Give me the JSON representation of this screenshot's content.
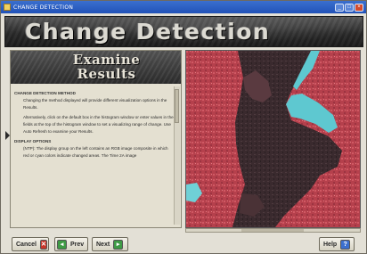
{
  "window": {
    "title": "CHANGE DETECTION",
    "controls": [
      "_",
      "□",
      "×"
    ]
  },
  "banner": {
    "title": "Change Detection"
  },
  "section": {
    "title_line1": "Examine",
    "title_line2": "Results"
  },
  "content": {
    "heading_methods": "CHANGE DETECTION METHOD",
    "para1": "Changing the method displayed will provide different visualization options in the Results.",
    "para2": "Alternatively, click on the default box in the histogram window or enter values in the fields at the top of the histogram window to set a visualizing range of change. Use Auto Refresh to examine your Results.",
    "heading_display": "DISPLAY OPTIONS",
    "para3": "(NTP): The display group on the left contains an RGB image composite in which red or cyan colors indicate changed areas. The Time 2A image"
  },
  "buttons": {
    "cancel": "Cancel",
    "prev": "Prev",
    "next": "Next",
    "help": "Help"
  },
  "icons": {
    "cancel": "close-icon",
    "prev": "arrow-left-icon",
    "next": "arrow-right-icon",
    "help": "question-icon"
  },
  "colors": {
    "titlebar": "#2152b8",
    "banner": "#2d2d2d",
    "cancel_icon": "#c8352a",
    "nav_icon": "#3e9a44",
    "help_icon": "#3b6fce",
    "change_red": "#c8454f",
    "change_cyan": "#5ec8d0"
  }
}
